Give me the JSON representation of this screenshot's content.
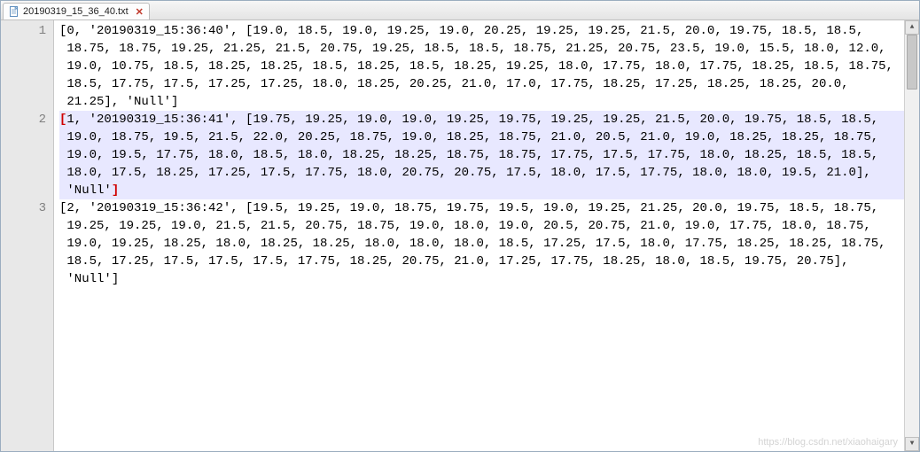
{
  "tab": {
    "filename": "20190319_15_36_40.txt"
  },
  "gutter": {
    "numbers": [
      "1",
      "",
      "",
      "",
      "",
      "",
      "",
      "2",
      "",
      "",
      "",
      "",
      "",
      "",
      "3",
      "",
      "",
      "",
      "",
      "",
      ""
    ]
  },
  "lines": [
    {
      "hl": false,
      "open_red": false,
      "close_red": false,
      "text": "[0, '20190319_15:36:40', [19.0, 18.5, 19.0, 19.25, 19.0, 20.25, 19.25, 19.25, 21.5, 20.0, 19.75, 18.5, 18.5, 18.75, 18.75, 19.25, 21.25, 21.5, 20.75, 19.25, 18.5, 18.5, 18.75, 21.25, 20.75, 23.5, 19.0, 15.5, 18.0, 12.0, 19.0, 10.75, 18.5, 18.25, 18.25, 18.5, 18.25, 18.5, 18.25, 19.25, 18.0, 17.75, 18.0, 17.75, 18.25, 18.5, 18.75, 18.5, 17.75, 17.5, 17.25, 17.25, 18.0, 18.25, 20.25, 21.0, 17.0, 17.75, 18.25, 17.25, 18.25, 18.25, 20.0, 21.25], 'Null']"
    },
    {
      "hl": true,
      "open_red": true,
      "close_red": true,
      "text": "1, '20190319_15:36:41', [19.75, 19.25, 19.0, 19.0, 19.25, 19.75, 19.25, 19.25, 21.5, 20.0, 19.75, 18.5, 18.5, 19.0, 18.75, 19.5, 21.5, 22.0, 20.25, 18.75, 19.0, 18.25, 18.75, 21.0, 20.5, 21.0, 19.0, 18.25, 18.25, 18.75, 19.0, 19.5, 17.75, 18.0, 18.5, 18.0, 18.25, 18.25, 18.75, 18.75, 17.75, 17.5, 17.75, 18.0, 18.25, 18.5, 18.5, 18.0, 17.5, 18.25, 17.25, 17.5, 17.75, 18.0, 20.75, 20.75, 17.5, 18.0, 17.5, 17.75, 18.0, 18.0, 19.5, 21.0], 'Null'"
    },
    {
      "hl": false,
      "open_red": false,
      "close_red": false,
      "text": "[2, '20190319_15:36:42', [19.5, 19.25, 19.0, 18.75, 19.75, 19.5, 19.0, 19.25, 21.25, 20.0, 19.75, 18.5, 18.75, 19.25, 19.25, 19.0, 21.5, 21.5, 20.75, 18.75, 19.0, 18.0, 19.0, 20.5, 20.75, 21.0, 19.0, 17.75, 18.0, 18.75, 19.0, 19.25, 18.25, 18.0, 18.25, 18.25, 18.0, 18.0, 18.0, 18.5, 17.25, 17.5, 18.0, 17.75, 18.25, 18.25, 18.75, 18.5, 17.25, 17.5, 17.5, 17.5, 17.75, 18.25, 20.75, 21.0, 17.25, 17.75, 18.25, 18.0, 18.5, 19.75, 20.75], 'Null']"
    }
  ],
  "watermark": "https://blog.csdn.net/xiaohaigary"
}
